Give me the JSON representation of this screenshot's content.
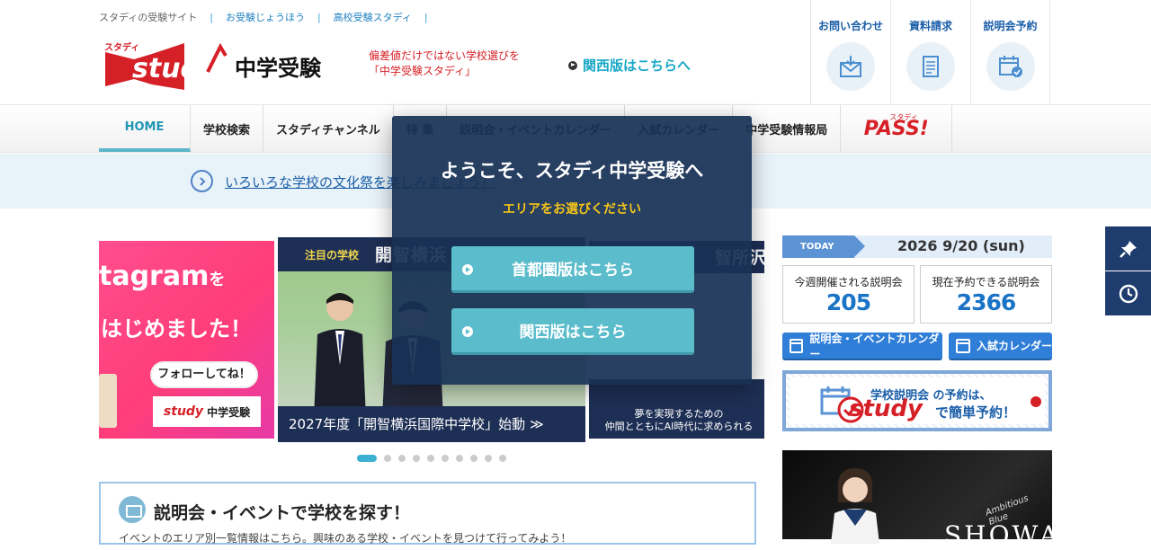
{
  "header": {
    "top_links": [
      "スタディの受験サイト",
      "お受験じょうほう",
      "高校受験スタディ"
    ],
    "logo_small": "スタディ",
    "logo_word": "study",
    "logo_jp": "中学受験",
    "tagline_line1": "偏差値だけではない学校選びを",
    "tagline_line2": "「中学受験スタディ」",
    "kansai_link": "関西版はこちらへ",
    "buttons": [
      {
        "label": "お問い合わせ",
        "icon": "mail-icon"
      },
      {
        "label": "資料請求",
        "icon": "document-icon"
      },
      {
        "label": "説明会予約",
        "icon": "calendar-check-icon"
      }
    ]
  },
  "nav": {
    "items": [
      "HOME",
      "学校検索",
      "スタディチャンネル",
      "特 集",
      "説明会・イベントカレンダー",
      "入試カレンダー",
      "中学受験情報局"
    ],
    "pass_small": "スタディ",
    "pass_label": "PASS!"
  },
  "notice": {
    "text": "いろいろな学校の文化祭を楽しみましょう！",
    "icon": "chevron-right-circle-icon"
  },
  "slider": {
    "slide_a_line1": "tagram",
    "slide_a_line1_suffix": "を",
    "slide_a_line2": "はじめました！",
    "slide_a_follow": "フォローしてね！",
    "slide_a_brand": "study",
    "slide_a_brand_jp": "中学受験",
    "slide_b_kicker": "注目の学校",
    "slide_b_name": "開智横浜",
    "slide_b_caption": "2027年度「開智横浜国際中学校」始動 ≫",
    "slide_c_name": "智所沢中",
    "slide_c_caption1": "夢を実現するための",
    "slide_c_caption2": "仲間とともにAI時代に求められる",
    "dots_total": 10,
    "dots_active": 0
  },
  "today": {
    "tag": "TODAY",
    "date": "2026 9/20 (sun)"
  },
  "counters": [
    {
      "label": "今週開催される説明会",
      "value": "205"
    },
    {
      "label": "現在予約できる説明会",
      "value": "2366"
    }
  ],
  "calendar_buttons": [
    "説明会・イベントカレンダー",
    "入試カレンダー"
  ],
  "promo": {
    "line1": "学校説明会 の予約は、",
    "brand": "study",
    "line2": "で簡単予約！"
  },
  "showa": {
    "title": "SHOWA",
    "script": "Ambitious Blue"
  },
  "search_box": {
    "title": "説明会・イベントで学校を探す！",
    "subtitle": "イベントのエリア別一覧情報はこちら。興味のある学校・イベントを見つけて行ってみよう！"
  },
  "overlay": {
    "title": "ようこそ、スタディ中学受験へ",
    "subtitle": "エリアをお選びください",
    "btn1": "首都圏版はこちら",
    "btn2": "関西版はこちら"
  },
  "colors": {
    "brand_red": "#d62027",
    "accent_blue": "#1a5ea8",
    "teal": "#5bbccb",
    "overlay_bg": "#183255"
  }
}
